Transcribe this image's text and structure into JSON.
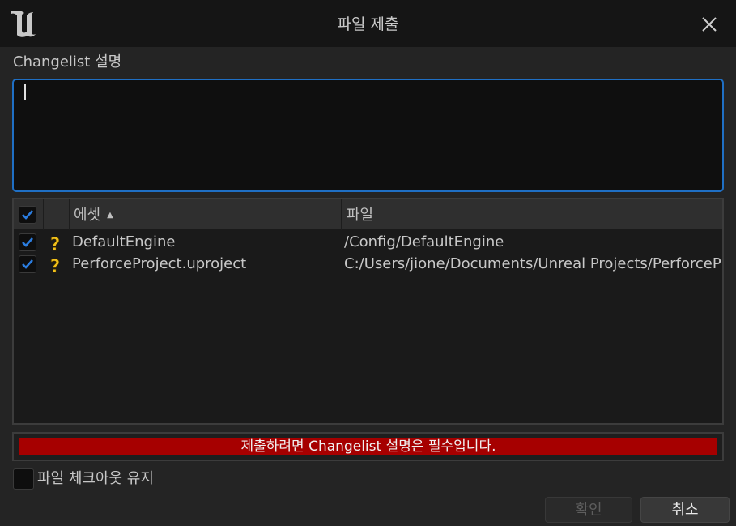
{
  "window": {
    "title": "파일 제출",
    "logo_icon": "unreal-engine-logo",
    "close_icon": "close-icon"
  },
  "description": {
    "label": "Changelist 설명",
    "value": ""
  },
  "file_list": {
    "columns": {
      "asset": "에셋",
      "file": "파일"
    },
    "sort": "ascending",
    "rows": [
      {
        "checked": true,
        "status_icon": "question-mark-icon",
        "asset": "DefaultEngine",
        "file": "/Config/DefaultEngine"
      },
      {
        "checked": true,
        "status_icon": "question-mark-icon",
        "asset": "PerforceProject.uproject",
        "file": "C:/Users/jione/Documents/Unreal Projects/PerforceProject/PerforceProject.uproject"
      }
    ]
  },
  "error": {
    "message": "제출하려면 Changelist 설명은 필수입니다.",
    "color": "#a60000"
  },
  "keep_checked_out": {
    "label": "파일 체크아웃 유지",
    "checked": false
  },
  "buttons": {
    "ok": "확인",
    "cancel": "취소"
  },
  "colors": {
    "accent": "#1f6fc4",
    "checkmark": "#2b7de0",
    "status_icon": "#f2c11a"
  }
}
